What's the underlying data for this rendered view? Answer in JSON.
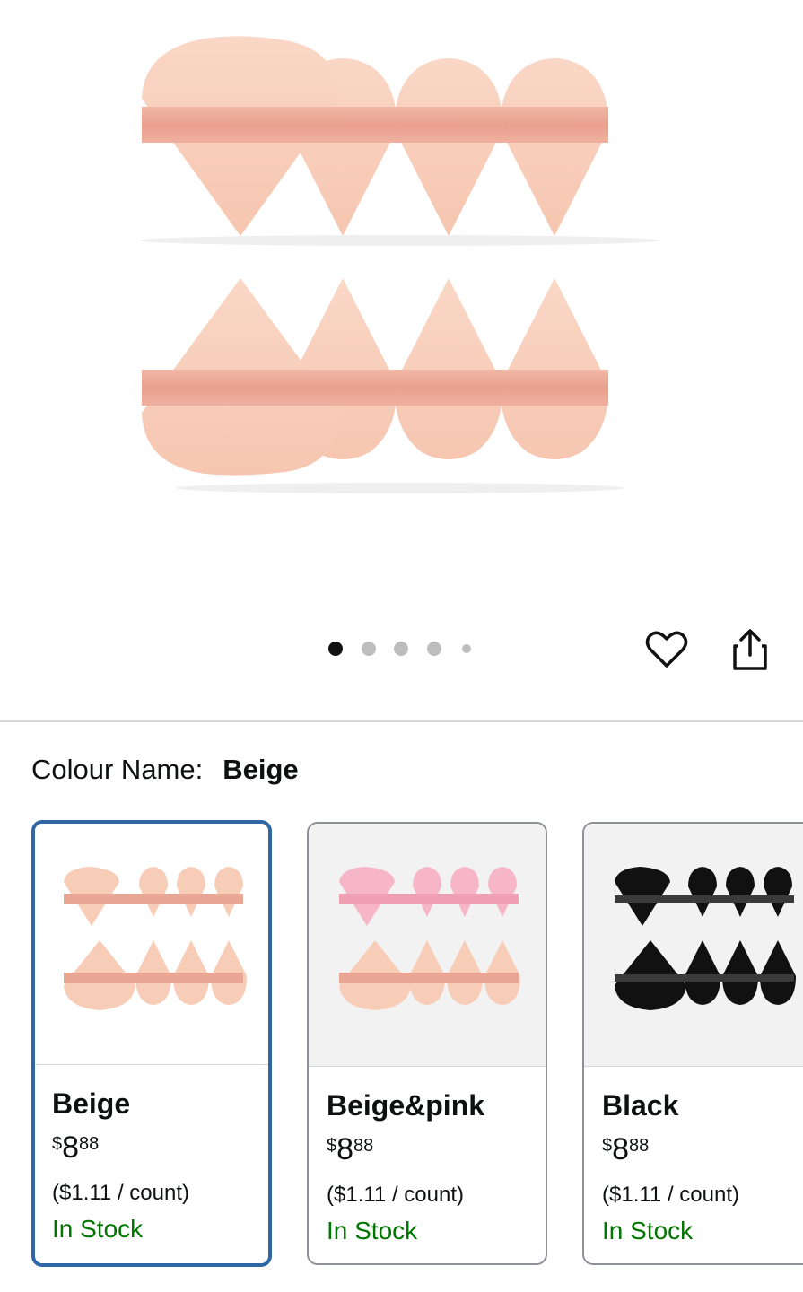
{
  "gallery": {
    "image_dots": 5,
    "active_dot": 0,
    "favorite_icon": "heart-outline-icon",
    "share_icon": "share-icon"
  },
  "variation": {
    "label": "Colour Name:",
    "selected_value": "Beige"
  },
  "options": [
    {
      "name": "Beige",
      "currency": "$",
      "price_whole": "8",
      "price_fraction": "88",
      "unit_price": "($1.11 / count)",
      "availability": "In Stock",
      "selected": true,
      "swatch_color": "#f8cdb8"
    },
    {
      "name": "Beige&pink",
      "currency": "$",
      "price_whole": "8",
      "price_fraction": "88",
      "unit_price": "($1.11 / count)",
      "availability": "In Stock",
      "selected": false,
      "swatch_color": "#f6b6c8"
    },
    {
      "name": "Black",
      "currency": "$",
      "price_whole": "8",
      "price_fraction": "88",
      "unit_price": "($1.11 / count)",
      "availability": "In Stock",
      "selected": false,
      "swatch_color": "#111111"
    }
  ],
  "colors": {
    "selected_border": "#2f67a5",
    "in_stock": "#007600",
    "puff_beige": "#f8cdb8",
    "ribbon_beige": "#eaa695",
    "puff_pink": "#f6b6c8"
  }
}
